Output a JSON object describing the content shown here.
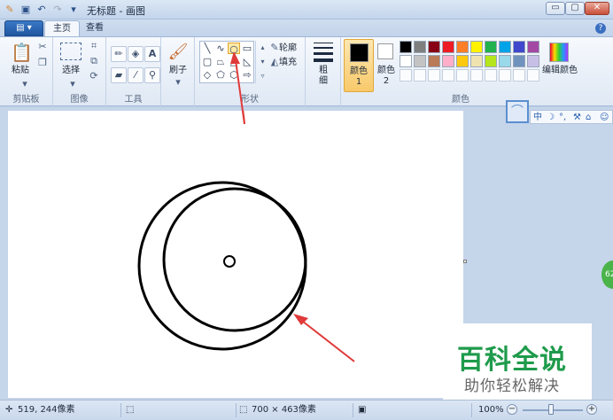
{
  "window": {
    "title": "无标题 - 画图",
    "buttons": {
      "minimize": "▭",
      "maximize": "▢",
      "close": "✕"
    }
  },
  "quick_access": {
    "icons": [
      "paint-app-icon",
      "save-icon",
      "undo-icon",
      "redo-icon",
      "customize-dropdown-icon"
    ]
  },
  "tabs": {
    "file_label": "▤ ▾",
    "home": "主页",
    "view": "查看",
    "help": "?"
  },
  "ribbon": {
    "clipboard": {
      "paste": "粘贴",
      "label": "剪贴板"
    },
    "image": {
      "select": "选择",
      "label": "图像"
    },
    "tools": {
      "label": "工具",
      "text_tool": "A"
    },
    "brushes": {
      "label": "刷子"
    },
    "shapes": {
      "outline": "轮廓",
      "fill": "填充",
      "label": "形状"
    },
    "size": {
      "label": "粗细"
    },
    "colors": {
      "color1": "颜色 1",
      "color2": "颜色 2",
      "edit": "编辑颜色",
      "label": "颜色"
    }
  },
  "palette": {
    "row1": [
      "#000000",
      "#7f7f7f",
      "#880015",
      "#ed1c24",
      "#ff7f27",
      "#fff200",
      "#22b14c",
      "#00a2e8",
      "#3f48cc",
      "#a349a4"
    ],
    "row2": [
      "#ffffff",
      "#c3c3c3",
      "#b97a57",
      "#ffaec9",
      "#ffc90e",
      "#efe4b0",
      "#b5e61d",
      "#99d9ea",
      "#7092be",
      "#c8bfe7"
    ]
  },
  "ime": {
    "items": [
      "中",
      "☽",
      "°,",
      "⚒",
      "⌂",
      "☺"
    ]
  },
  "side_badge": "62",
  "watermark": {
    "title": "百科全说",
    "subtitle": "助你轻松解决"
  },
  "status": {
    "cursor_pos": "519, 244像素",
    "canvas_size": "700 × 463像素",
    "zoom": "100%",
    "zoom_level": 1.0
  }
}
